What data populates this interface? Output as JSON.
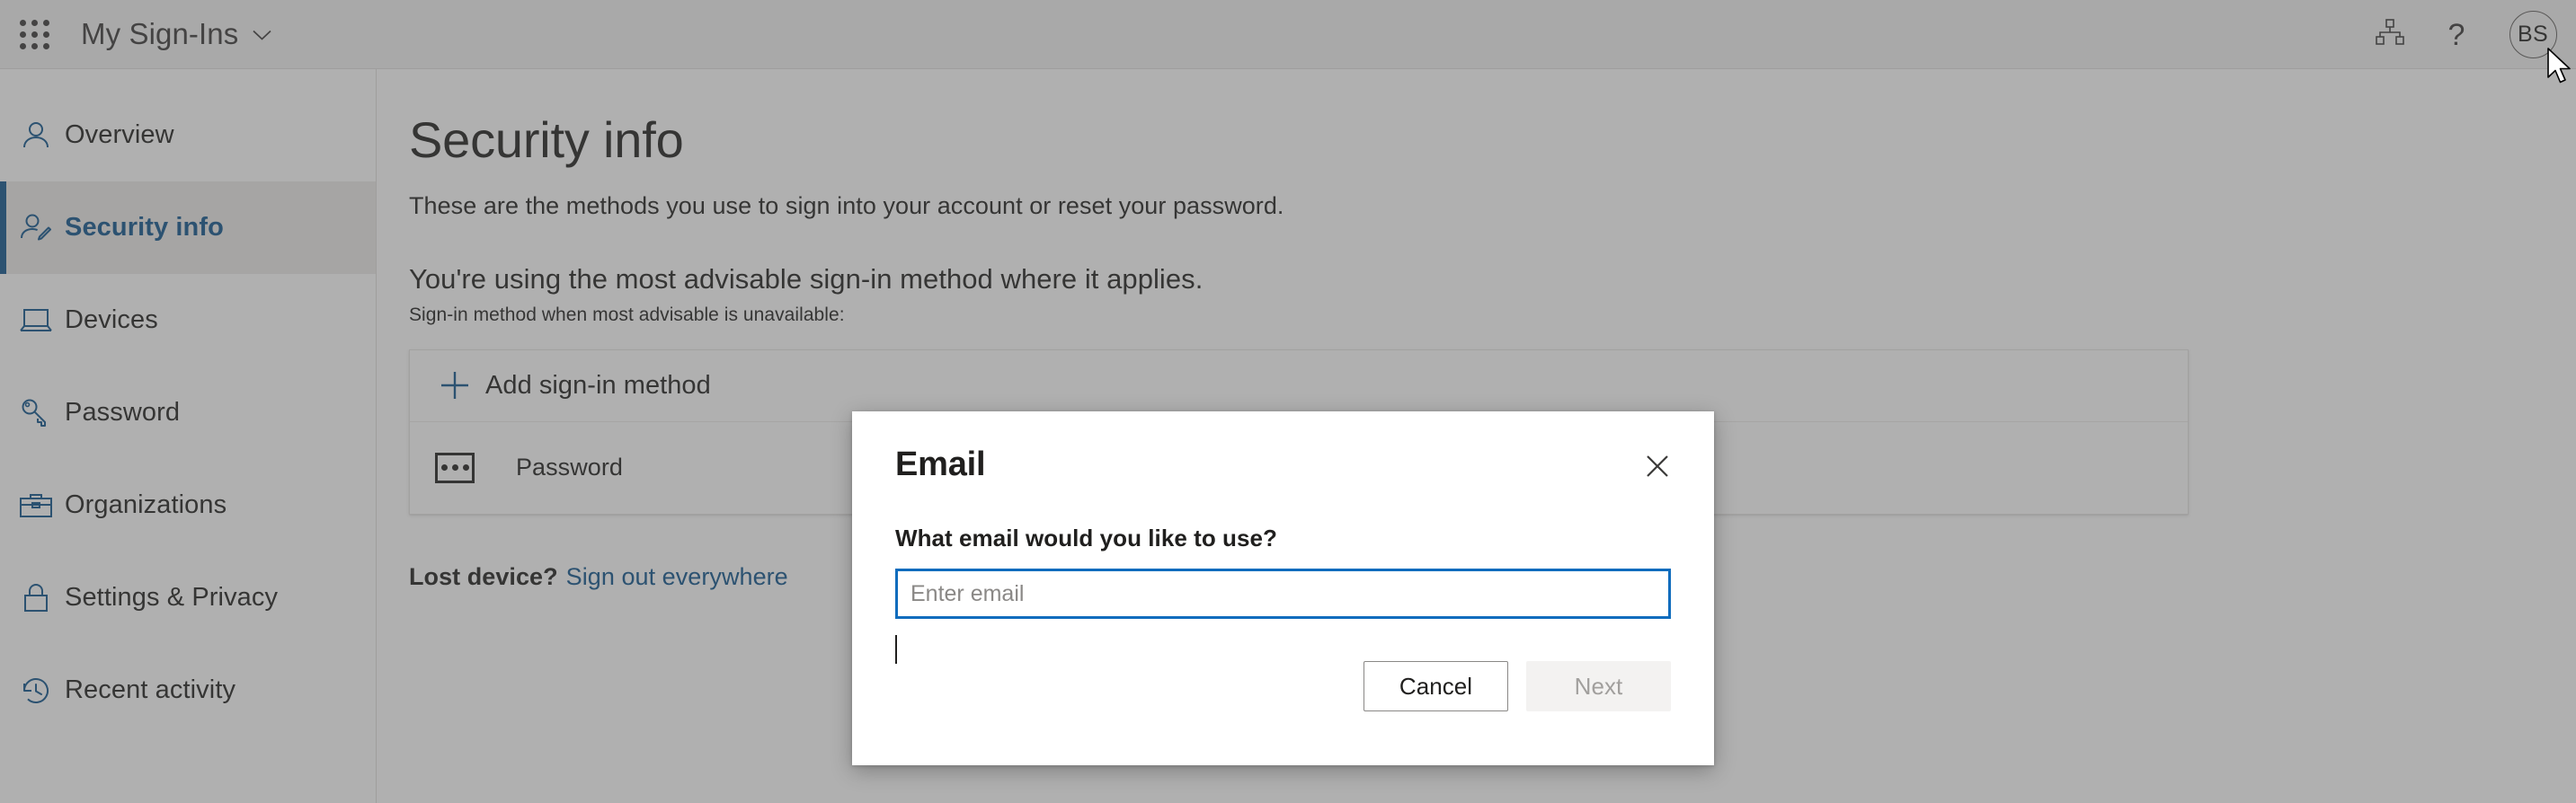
{
  "header": {
    "waffle_icon": "app-launcher-waffle-icon",
    "brand_title": "My Sign-Ins",
    "brand_chevron_icon": "chevron-down-icon",
    "org_icon": "org-hierarchy-icon",
    "help_icon": "question-mark-icon",
    "help_glyph": "?",
    "avatar_initials": "BS"
  },
  "sidebar": {
    "items": [
      {
        "label": "Overview",
        "icon": "person-icon",
        "selected": false
      },
      {
        "label": "Security info",
        "icon": "person-edit-icon",
        "selected": true
      },
      {
        "label": "Devices",
        "icon": "laptop-icon",
        "selected": false
      },
      {
        "label": "Password",
        "icon": "key-icon",
        "selected": false
      },
      {
        "label": "Organizations",
        "icon": "briefcase-icon",
        "selected": false
      },
      {
        "label": "Settings & Privacy",
        "icon": "lock-icon",
        "selected": false
      },
      {
        "label": "Recent activity",
        "icon": "history-clock-icon",
        "selected": false
      }
    ]
  },
  "main": {
    "page_title": "Security info",
    "page_subtitle": "These are the methods you use to sign into your account or reset your password.",
    "advisable_line": "You're using the most advisable sign-in method where it applies.",
    "advisable_sub": "Sign-in method when most advisable is unavailable:",
    "add_method_label": "Add sign-in method",
    "add_method_icon": "plus-icon",
    "methods": [
      {
        "label": "Password",
        "icon": "password-dots-icon"
      }
    ],
    "lost_device_label": "Lost device?",
    "sign_out_link": "Sign out everywhere"
  },
  "dialog": {
    "title": "Email",
    "close_icon": "close-x-icon",
    "question": "What email would you like to use?",
    "input_value": "",
    "input_placeholder": "Enter email",
    "cancel_label": "Cancel",
    "next_label": "Next",
    "next_disabled": true
  },
  "colors": {
    "accent_blue": "#0f548c",
    "focus_blue": "#0f6cbd",
    "text_dark": "#201f1e",
    "header_bg": "#f2f2f2",
    "selected_nav_bg": "#edebe9",
    "disabled_btn_bg": "#f3f2f1",
    "disabled_btn_text": "#a19f9d",
    "backdrop": "rgba(80,80,80,0.45)"
  }
}
